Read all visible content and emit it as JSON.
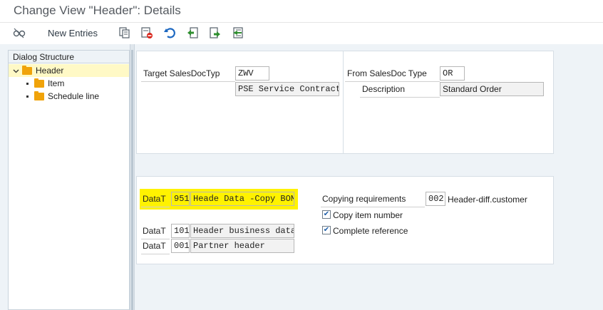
{
  "window": {
    "title": "Change View \"Header\": Details"
  },
  "toolbar": {
    "new_entries_label": "New Entries",
    "icons": [
      "display-change-icon",
      "copy-icon",
      "delete-icon",
      "undo-icon",
      "previous-entry-icon",
      "next-entry-icon",
      "select-icon"
    ]
  },
  "dialog_structure": {
    "title": "Dialog Structure",
    "items": [
      {
        "label": "Header",
        "selected": true,
        "level": 0
      },
      {
        "label": "Item",
        "selected": false,
        "level": 1
      },
      {
        "label": "Schedule line",
        "selected": false,
        "level": 1
      }
    ]
  },
  "target": {
    "label": "Target SalesDocTyp",
    "value": "ZWV",
    "description": "PSE Service Contract"
  },
  "source": {
    "label": "From SalesDoc Type",
    "value": "OR",
    "description_label": "Description",
    "description": "Standard Order"
  },
  "data_transfer": [
    {
      "label": "DataT",
      "code": "951",
      "text": "Heade Data -Copy BOM",
      "highlighted": true
    },
    {
      "label": "DataT",
      "code": "101",
      "text": "Header business data",
      "highlighted": false
    },
    {
      "label": "DataT",
      "code": "001",
      "text": "Partner header",
      "highlighted": false
    }
  ],
  "copying": {
    "label": "Copying requirements",
    "code": "002",
    "text": "Header-diff.customer",
    "copy_item_number_label": "Copy item number",
    "copy_item_number_checked": true,
    "complete_reference_label": "Complete reference",
    "complete_reference_checked": true
  },
  "colors": {
    "highlight": "#fff200",
    "folder": "#f0a30a",
    "selected_row": "#fff9c6",
    "background": "#eef3f7"
  }
}
